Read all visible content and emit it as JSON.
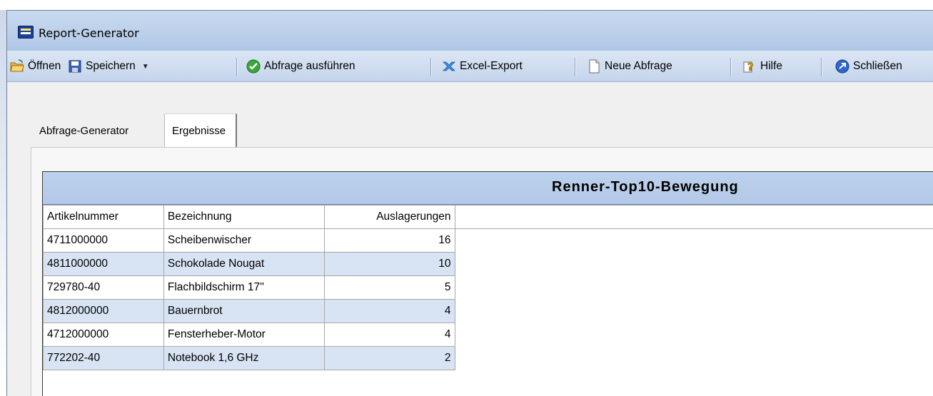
{
  "window": {
    "title": "Report-Generator",
    "icon": "report-app-icon"
  },
  "toolbar": {
    "open_label": "Öffnen",
    "save_label": "Speichern",
    "run_label": "Abfrage ausführen",
    "excel_label": "Excel-Export",
    "new_label": "Neue Abfrage",
    "help_label": "Hilfe",
    "close_label": "Schließen"
  },
  "tabs": [
    {
      "label": "Abfrage-Generator",
      "active": false
    },
    {
      "label": "Ergebnisse",
      "active": true
    }
  ],
  "report": {
    "title": "Renner-Top10-Bewegung",
    "columns": [
      "Artikelnummer",
      "Bezeichnung",
      "Auslagerungen"
    ],
    "rows": [
      {
        "artikelnummer": "4711000000",
        "bezeichnung": "Scheibenwischer",
        "auslagerungen": "16"
      },
      {
        "artikelnummer": "4811000000",
        "bezeichnung": "Schokolade Nougat",
        "auslagerungen": "10"
      },
      {
        "artikelnummer": "729780-40",
        "bezeichnung": "Flachbildschirm 17''",
        "auslagerungen": "5"
      },
      {
        "artikelnummer": "4812000000",
        "bezeichnung": "Bauernbrot",
        "auslagerungen": "4"
      },
      {
        "artikelnummer": "4712000000",
        "bezeichnung": "Fensterheber-Motor",
        "auslagerungen": "4"
      },
      {
        "artikelnummer": "772202-40",
        "bezeichnung": "Notebook 1,6 GHz",
        "auslagerungen": "2"
      }
    ]
  },
  "colors": {
    "title_bar": "#bcd0ea",
    "toolbar": "#cfdcef",
    "report_header": "#b8cdea",
    "alt_row": "#d8e4f4"
  }
}
